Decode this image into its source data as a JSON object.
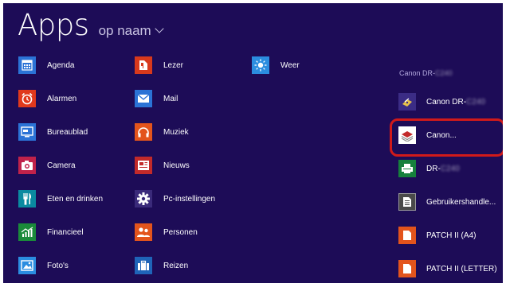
{
  "header": {
    "title": "Apps",
    "sort_label": "op naam"
  },
  "col1": [
    {
      "label": "Agenda",
      "icon": "calendar-icon"
    },
    {
      "label": "Alarmen",
      "icon": "alarm-clock-icon"
    },
    {
      "label": "Bureaublad",
      "icon": "desktop-icon"
    },
    {
      "label": "Camera",
      "icon": "camera-icon"
    },
    {
      "label": "Eten en drinken",
      "icon": "food-icon"
    },
    {
      "label": "Financieel",
      "icon": "finance-chart-icon"
    },
    {
      "label": "Foto's",
      "icon": "photos-icon"
    }
  ],
  "col2": [
    {
      "label": "Lezer",
      "icon": "reader-icon"
    },
    {
      "label": "Mail",
      "icon": "mail-icon"
    },
    {
      "label": "Muziek",
      "icon": "headphones-icon"
    },
    {
      "label": "Nieuws",
      "icon": "news-icon"
    },
    {
      "label": "Pc-instellingen",
      "icon": "gear-icon"
    },
    {
      "label": "Personen",
      "icon": "people-icon"
    },
    {
      "label": "Reizen",
      "icon": "suitcase-icon"
    }
  ],
  "col3": [
    {
      "label": "Weer",
      "icon": "sun-icon"
    }
  ],
  "group": {
    "header": "Canon DR-"
  },
  "col4": [
    {
      "label": "Canon DR-",
      "icon": "canon-driver-icon"
    },
    {
      "label": "Canon...",
      "icon": "canon-capture-icon"
    },
    {
      "label": "DR-",
      "icon": "scanner-icon"
    },
    {
      "label": "Gebruikershandle...",
      "icon": "manual-document-icon"
    },
    {
      "label": "PATCH II (A4)",
      "icon": "pdf-document-icon"
    },
    {
      "label": "PATCH II (LETTER)",
      "icon": "pdf-document-icon"
    }
  ]
}
